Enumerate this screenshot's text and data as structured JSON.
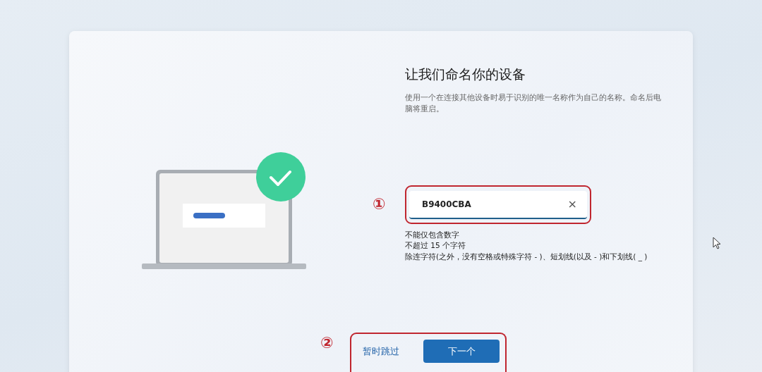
{
  "title": "让我们命名你的设备",
  "description": "使用一个在连接其他设备时易于识别的唯一名称作为自己的名称。命名后电脑将重启。",
  "name_field": {
    "value": "B9400CBA",
    "marker": "①",
    "clear_label": "×"
  },
  "hints": [
    "不能仅包含数字",
    "不超过 15 个字符",
    "除连字符(之外，没有空格或特殊字符 - )、短划线(以及 - )和下划线( _ )"
  ],
  "footer": {
    "marker": "②",
    "buttons": [
      {
        "label": "暂时跳过",
        "kind": "link"
      },
      {
        "label": "下一个",
        "kind": "primary"
      }
    ]
  }
}
